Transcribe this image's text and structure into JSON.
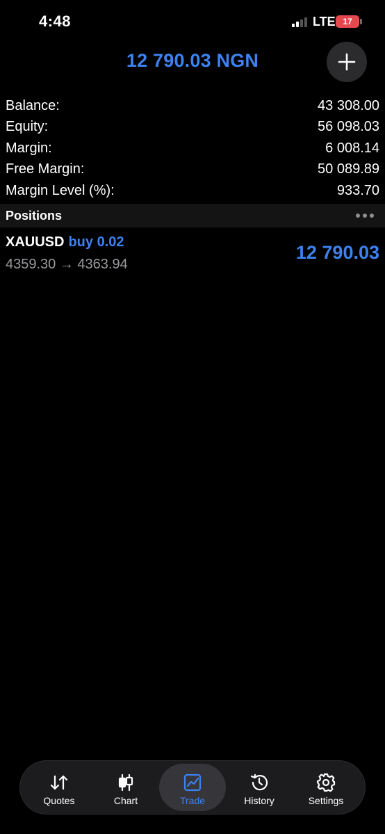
{
  "status_bar": {
    "time": "4:48",
    "network": "LTE",
    "battery": "17"
  },
  "header": {
    "total": "12 790.03 NGN",
    "add_icon": "plus-icon"
  },
  "account": {
    "rows": [
      {
        "label": "Balance:",
        "value": "43 308.00"
      },
      {
        "label": "Equity:",
        "value": "56 098.03"
      },
      {
        "label": "Margin:",
        "value": "6 008.14"
      },
      {
        "label": "Free Margin:",
        "value": "50 089.89"
      },
      {
        "label": "Margin Level (%):",
        "value": "933.70"
      }
    ]
  },
  "positions": {
    "title": "Positions",
    "items": [
      {
        "symbol": "XAUUSD",
        "side": "buy 0.02",
        "prices": "4359.30 → 4363.94",
        "profit": "12 790.03"
      }
    ]
  },
  "tab_bar": {
    "tabs": [
      {
        "label": "Quotes",
        "icon": "arrows-updown-icon"
      },
      {
        "label": "Chart",
        "icon": "candlestick-icon"
      },
      {
        "label": "Trade",
        "icon": "trade-chart-icon",
        "active": true
      },
      {
        "label": "History",
        "icon": "history-clock-icon"
      },
      {
        "label": "Settings",
        "icon": "gear-icon"
      }
    ]
  },
  "colors": {
    "accent": "#3d82f0",
    "background": "#000000",
    "battery": "#e5484d"
  }
}
